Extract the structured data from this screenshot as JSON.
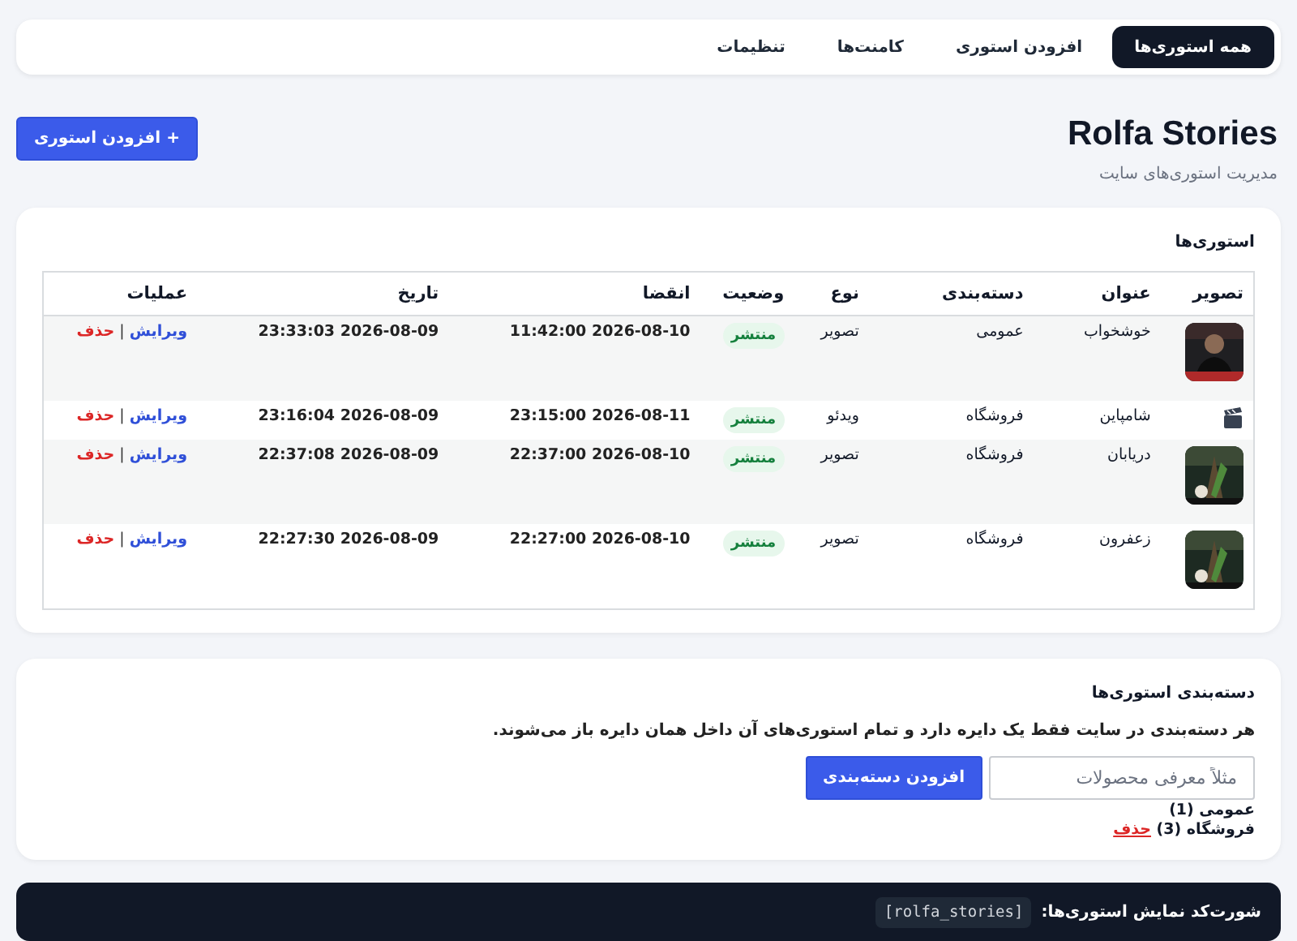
{
  "nav": {
    "tabs": [
      {
        "label": "همه استوری‌ها",
        "selected": true
      },
      {
        "label": "افزودن استوری",
        "selected": false
      },
      {
        "label": "کامنت‌ها",
        "selected": false
      },
      {
        "label": "تنظیمات",
        "selected": false
      }
    ]
  },
  "header": {
    "title": "Rolfa Stories",
    "subtitle": "مدیریت استوری‌های سایت",
    "add_button": "+ افزودن استوری"
  },
  "stories": {
    "heading": "استوری‌ها",
    "columns": [
      "تصویر",
      "عنوان",
      "دسته‌بندی",
      "نوع",
      "وضعیت",
      "انقضا",
      "تاریخ",
      "عملیات"
    ],
    "rows": [
      {
        "title": "خوشخواب",
        "category": "عمومی",
        "type": "تصویر",
        "status": "منتشر",
        "expires": "2026-08-10 11:42:00",
        "date": "2026-08-09 23:33:03",
        "edit": "ویرایش",
        "separator": "|",
        "delete": "حذف"
      },
      {
        "thumbnail": {
          "kind": "video"
        },
        "title": "شامپاین",
        "category": "فروشگاه",
        "type": "ویدئو",
        "status": "منتشر",
        "expires": "2026-08-11 23:15:00",
        "date": "2026-08-09 23:16:04",
        "edit": "ویرایش",
        "separator": "|",
        "delete": "حذف"
      },
      {
        "title": "دریابان",
        "category": "فروشگاه",
        "type": "تصویر",
        "status": "منتشر",
        "expires": "2026-08-10 22:37:00",
        "date": "2026-08-09 22:37:08",
        "edit": "ویرایش",
        "separator": "|",
        "delete": "حذف"
      },
      {
        "title": "زعفرون",
        "category": "فروشگاه",
        "type": "تصویر",
        "status": "منتشر",
        "expires": "2026-08-10 22:27:00",
        "date": "2026-08-09 22:27:30",
        "edit": "ویرایش",
        "separator": "|",
        "delete": "حذف"
      }
    ]
  },
  "categories": {
    "heading": "دسته‌بندی استوری‌ها",
    "description": "هر دسته‌بندی در سایت فقط یک دایره دارد و تمام استوری‌های آن داخل همان دایره باز می‌شوند.",
    "input": {
      "placeholder": "مثلاً معرفی محصولات"
    },
    "add_button": "افزودن دسته‌بندی",
    "items": [
      {
        "label": "عمومی (1)"
      },
      {
        "label": "فروشگاه (3)",
        "delete": "حذف"
      }
    ]
  },
  "shortcode": {
    "label": "شورت‌کد نمایش استوری‌ها:",
    "code": "[rolfa_stories]"
  }
}
